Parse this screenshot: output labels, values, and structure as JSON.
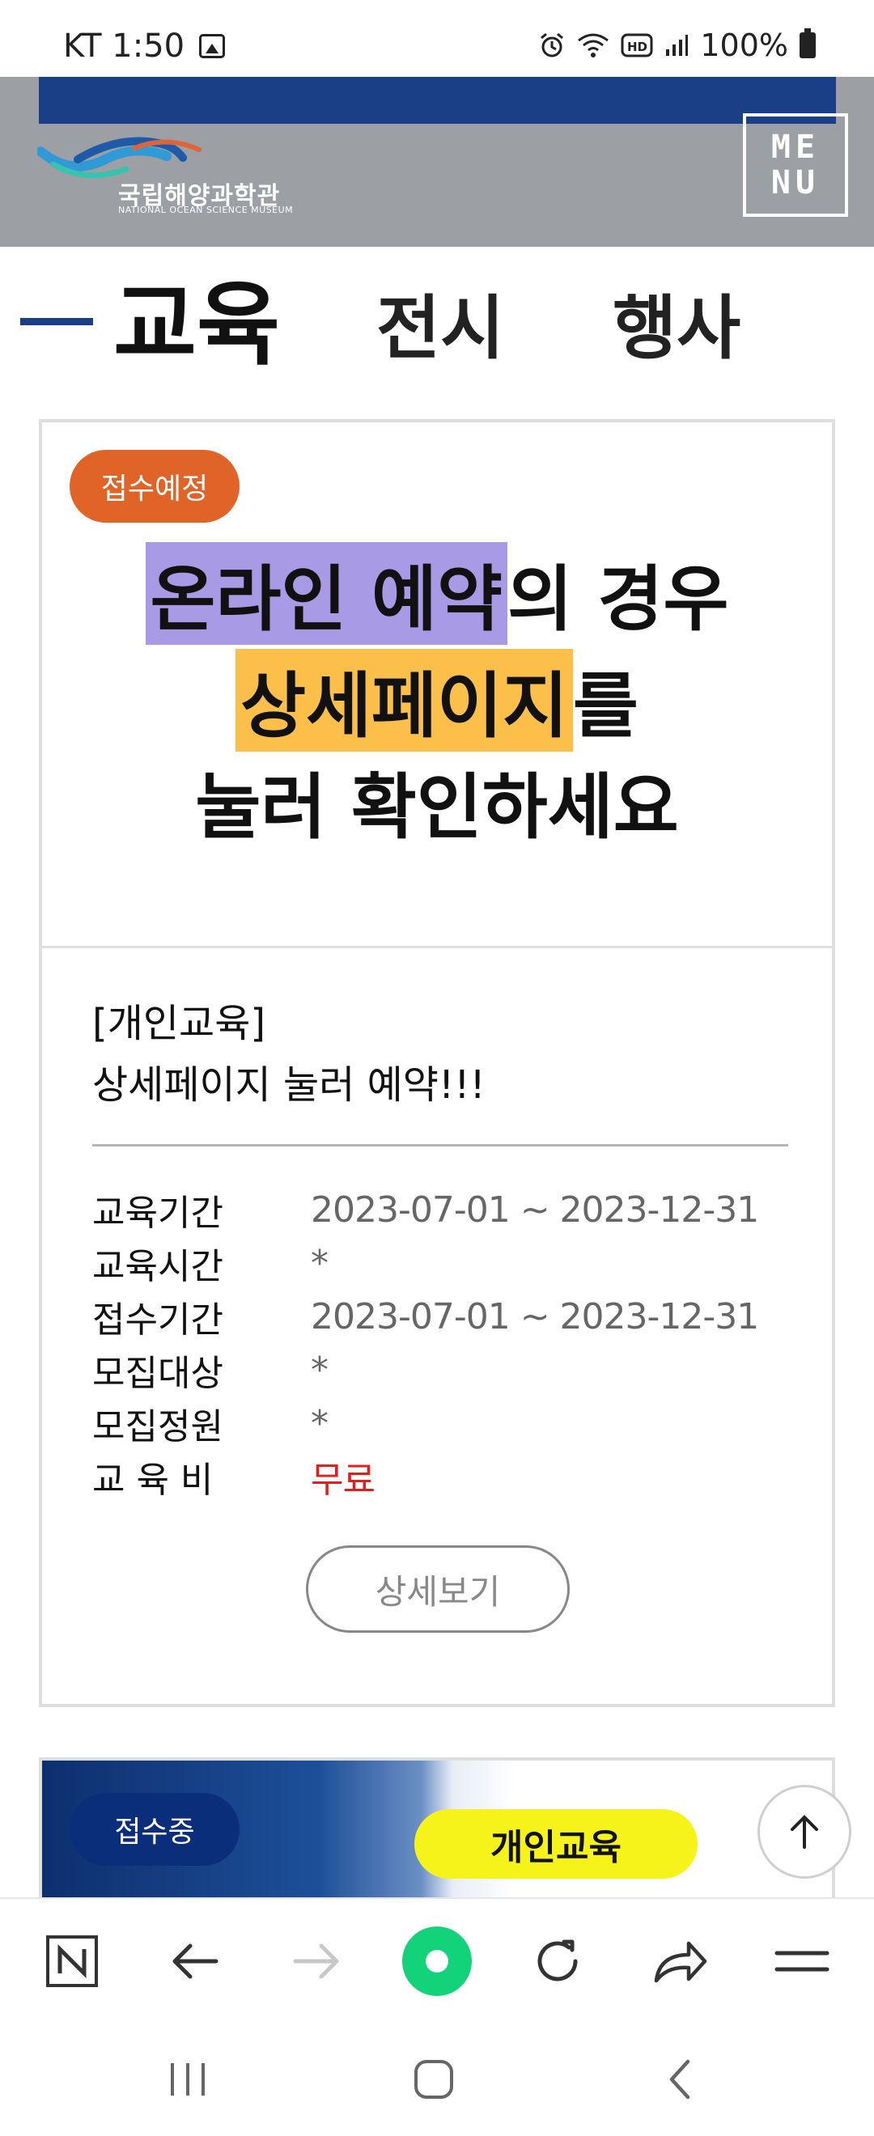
{
  "status_bar": {
    "carrier_time": "KT 1:50",
    "battery": "100%",
    "icons": [
      "image-icon",
      "alarm-icon",
      "wifi-icon",
      "hd-icon",
      "signal-icon",
      "battery-icon"
    ]
  },
  "header": {
    "logo_text": "국립해양과학관",
    "logo_sub": "NATIONAL OCEAN SCIENCE MUSEUM",
    "menu_line1": "ME",
    "menu_line2": "NU",
    "bar_color": "#1a3f86"
  },
  "tabs": [
    {
      "label": "교육",
      "active": true
    },
    {
      "label": "전시",
      "active": false
    },
    {
      "label": "행사",
      "active": false
    }
  ],
  "card": {
    "badge": "접수예정",
    "badge_color": "#e06327",
    "promo": {
      "line1_hl": "온라인 예약",
      "line1_rest": "의 경우",
      "line2_hl": "상세페이지",
      "line2_rest": "를",
      "line3": "눌러 확인하세요"
    },
    "title_line1": "[개인교육]",
    "title_line2": "상세페이지 눌러 예약!!!",
    "info": [
      {
        "label": "교육기간",
        "value": "2023-07-01 ~ 2023-12-31"
      },
      {
        "label": "교육시간",
        "value": "*"
      },
      {
        "label": "접수기간",
        "value": "2023-07-01 ~ 2023-12-31"
      },
      {
        "label": "모집대상",
        "value": "*"
      },
      {
        "label": "모집정원",
        "value": "*"
      },
      {
        "label": "교 육 비",
        "value": "무료"
      }
    ],
    "detail_button": "상세보기"
  },
  "card2": {
    "badge": "접수중",
    "pill": "개인교육"
  }
}
